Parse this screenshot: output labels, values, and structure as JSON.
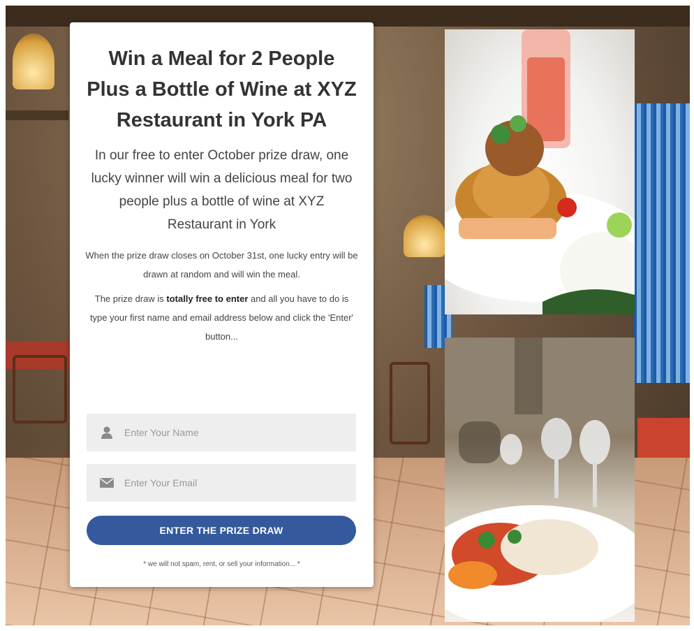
{
  "promo": {
    "headline": "Win a Meal for 2 People Plus a Bottle of Wine at XYZ Restaurant in York PA",
    "lead": "In our free to enter October prize draw, one lucky winner will win a delicious meal for two people plus a bottle of wine at XYZ Restaurant in York",
    "draw_info": "When the prize draw closes on October 31st, one lucky entry will be drawn at random and will win the meal.",
    "free_prefix": "The prize draw is ",
    "free_bold": "totally free to enter",
    "free_suffix": " and all you have to do is type your first name and email address below and click the 'Enter' button..."
  },
  "form": {
    "name_placeholder": "Enter Your Name",
    "email_placeholder": "Enter Your Email",
    "name_icon": "user-icon",
    "email_icon": "envelope-icon",
    "submit_label": "ENTER THE PRIZE DRAW",
    "disclaimer": "* we will not spam, rent, or sell your information... *",
    "button_color": "#34599d"
  }
}
